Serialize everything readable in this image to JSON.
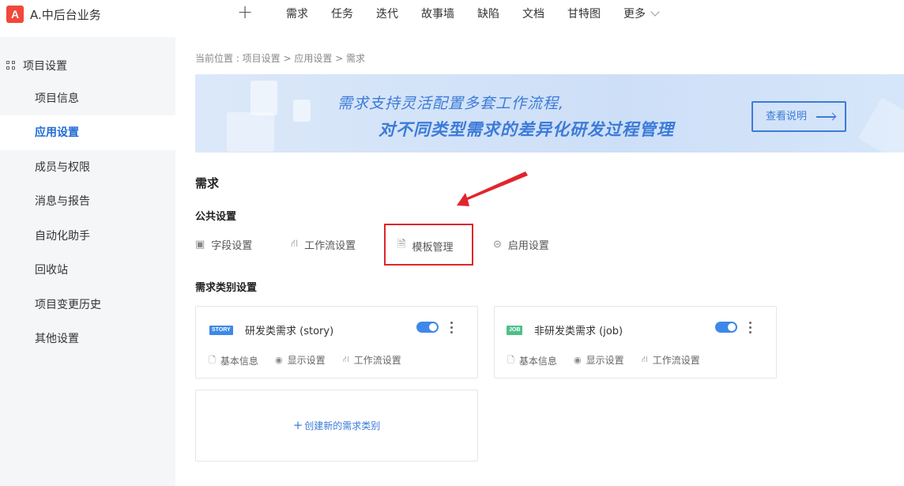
{
  "app": {
    "logo_letter": "A",
    "title": "A.中后台业务"
  },
  "topnav": {
    "plus": "+",
    "items": [
      "需求",
      "任务",
      "迭代",
      "故事墙",
      "缺陷",
      "文档",
      "甘特图"
    ],
    "more": "更多"
  },
  "sidebar": {
    "heading": "项目设置",
    "items": [
      {
        "label": "项目信息"
      },
      {
        "label": "应用设置"
      },
      {
        "label": "成员与权限"
      },
      {
        "label": "消息与报告"
      },
      {
        "label": "自动化助手"
      },
      {
        "label": "回收站"
      },
      {
        "label": "项目变更历史"
      },
      {
        "label": "其他设置"
      }
    ]
  },
  "breadcrumb": "当前位置 :  项目设置 > 应用设置 > 需求",
  "banner": {
    "line1": "需求支持灵活配置多套工作流程,",
    "line2": "对不同类型需求的差异化研发过程管理",
    "button": "查看说明"
  },
  "section": {
    "title": "需求",
    "public_title": "公共设置",
    "public_links": [
      {
        "label": "字段设置",
        "icon": "field-icon"
      },
      {
        "label": "工作流设置",
        "icon": "workflow-icon"
      },
      {
        "label": "模板管理",
        "icon": "template-icon"
      },
      {
        "label": "启用设置",
        "icon": "toggle-icon"
      }
    ],
    "category_title": "需求类别设置"
  },
  "cards": [
    {
      "badge": "STORY",
      "badge_color": "#3d88e8",
      "title": "研发类需求 (story)",
      "links": [
        "基本信息",
        "显示设置",
        "工作流设置"
      ]
    },
    {
      "badge": "JOB",
      "badge_color": "#4fbf8a",
      "title": "非研发类需求 (job)",
      "links": [
        "基本信息",
        "显示设置",
        "工作流设置"
      ]
    }
  ],
  "create_card": {
    "label": "创建新的需求类别"
  },
  "colors": {
    "accent": "#3d7bd8",
    "highlight": "#e0252c",
    "active_nav": "#1f6bd6"
  }
}
